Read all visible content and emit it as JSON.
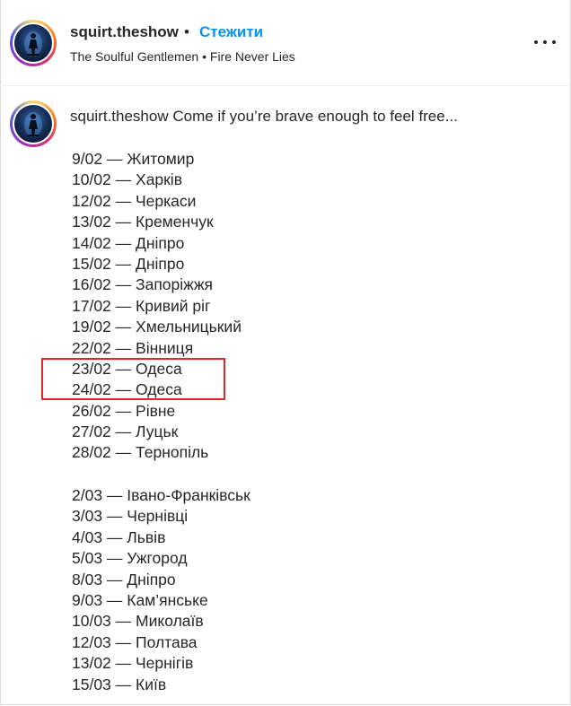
{
  "post": {
    "username": "squirt.theshow",
    "separator": "•",
    "follow_label": "Стежити",
    "music": {
      "artist": "The Soulful Gentlemen",
      "separator": "•",
      "track": "Fire Never Lies"
    },
    "more_icon": "more-horizontal-icon"
  },
  "caption": {
    "username": "squirt.theshow",
    "text": "Come if you’re brave enough to feel free...",
    "february": [
      "9/02 — Житомир",
      "10/02 — Харків",
      "12/02 — Черкаси",
      "13/02 — Кременчук",
      "14/02 — Дніпро",
      "15/02 — Дніпро",
      "16/02 — Запоріжжя",
      "17/02 — Кривий ріг",
      "19/02 — Хмельницький",
      "22/02 — Вінниця",
      "23/02 — Одеса",
      "24/02 — Одеса",
      "26/02 — Рівне",
      "27/02 — Луцьк",
      "28/02 — Тернопіль"
    ],
    "march": [
      "2/03 — Івано-Франківськ",
      "3/03 — Чернівці",
      "4/03 — Львів",
      "5/03 — Ужгород",
      "8/03 — Дніпро",
      "9/03 — Кам’янське",
      "10/03 — Миколаїв",
      "12/03 — Полтава",
      "13/02 — Чернігів",
      "15/03 — Київ"
    ]
  },
  "colors": {
    "follow": "#0095f6",
    "highlight": "#e0262a",
    "text": "#262626"
  }
}
